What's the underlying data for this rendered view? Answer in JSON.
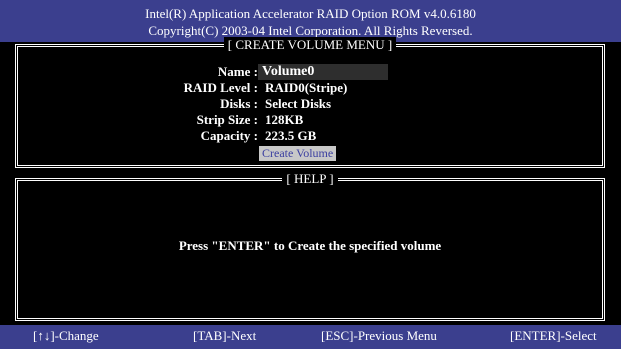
{
  "header": {
    "line1": "Intel(R) Application Accelerator RAID Option ROM v4.0.6180",
    "line2": "Copyright(C) 2003-04 Intel Corporation.  All Rights Reversed."
  },
  "create_menu": {
    "title": "[ CREATE VOLUME MENU ]",
    "fields": [
      {
        "label": "Name :",
        "value": "Volume0"
      },
      {
        "label": "RAID Level :",
        "value": "RAID0(Stripe)"
      },
      {
        "label": "Disks :",
        "value": "Select Disks"
      },
      {
        "label": "Strip Size :",
        "value": "128KB"
      },
      {
        "label": "Capacity :",
        "value": "223.5 GB"
      }
    ],
    "create_button": "Create Volume"
  },
  "help": {
    "title": "[ HELP ]",
    "text": "Press \"ENTER\" to Create the specified volume"
  },
  "footer": {
    "change": "[↑↓]-Change",
    "next": "[TAB]-Next",
    "previous": "[ESC]-Previous Menu",
    "select": "[ENTER]-Select"
  },
  "colors": {
    "bar_background": "#3b3f8e",
    "button_background": "#c8c8c8",
    "button_text": "#3a3ea0"
  }
}
